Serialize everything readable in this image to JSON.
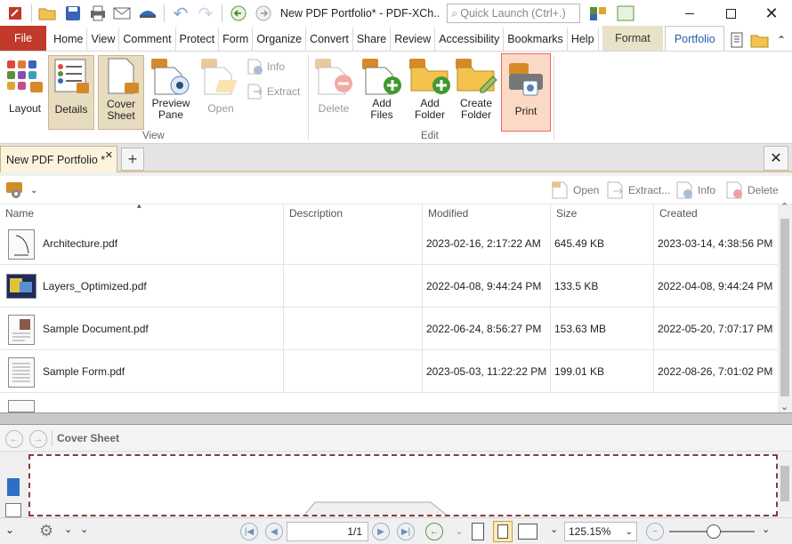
{
  "app": {
    "title": "New PDF Portfolio* - PDF-XCh..",
    "quick_launch_placeholder": "Quick Launch (Ctrl+.)"
  },
  "menu": {
    "file": "File",
    "items": [
      "Home",
      "View",
      "Comment",
      "Protect",
      "Form",
      "Organize",
      "Convert",
      "Share",
      "Review",
      "Accessibility",
      "Bookmarks",
      "Help"
    ],
    "format": "Format",
    "portfolio": "Portfolio"
  },
  "ribbon": {
    "layout": "Layout",
    "details": "Details",
    "cover_sheet": "Cover Sheet",
    "preview_pane": "Preview Pane",
    "open": "Open",
    "info": "Info",
    "extract": "Extract",
    "delete": "Delete",
    "add_files": "Add Files",
    "add_folder": "Add Folder",
    "create_folder": "Create Folder",
    "print": "Print",
    "group_view": "View",
    "group_edit": "Edit"
  },
  "doc_tab": {
    "label": "New PDF Portfolio *"
  },
  "list_toolbar": {
    "open": "Open",
    "extract": "Extract...",
    "info": "Info",
    "delete": "Delete"
  },
  "columns": [
    "Name",
    "Description",
    "Modified",
    "Size",
    "Created"
  ],
  "files": [
    {
      "name": "Architecture.pdf",
      "description": "",
      "modified": "2023-02-16, 2:17:22 AM",
      "size": "645.49 KB",
      "created": "2023-03-14, 4:38:56 PM"
    },
    {
      "name": "Layers_Optimized.pdf",
      "description": "",
      "modified": "2022-04-08, 9:44:24 PM",
      "size": "133.5 KB",
      "created": "2022-04-08, 9:44:24 PM"
    },
    {
      "name": "Sample Document.pdf",
      "description": "",
      "modified": "2022-06-24, 8:56:27 PM",
      "size": "153.63 MB",
      "created": "2022-05-20, 7:07:17 PM"
    },
    {
      "name": "Sample Form.pdf",
      "description": "",
      "modified": "2023-05-03, 11:22:22 PM",
      "size": "199.01 KB",
      "created": "2022-08-26, 7:01:02 PM"
    }
  ],
  "preview_nav": {
    "label": "Cover Sheet"
  },
  "status": {
    "page": "1/1",
    "zoom": "125.15%"
  }
}
